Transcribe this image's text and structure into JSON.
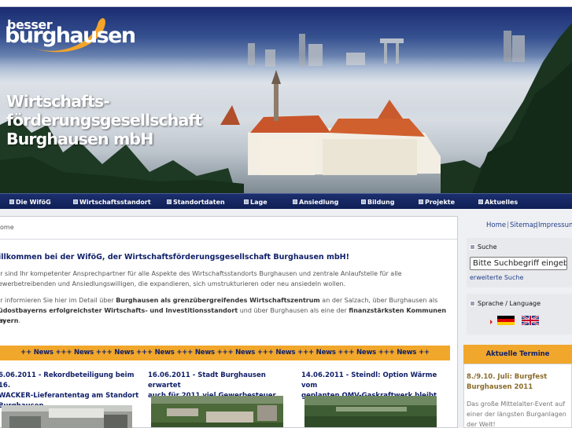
{
  "header": {
    "logo_small": "besser",
    "logo_big": "burghausen",
    "title_lines": [
      "Wirtschafts-",
      "förderungsgesellschaft",
      "Burghausen mbH"
    ]
  },
  "nav": {
    "items": [
      {
        "label": "Die WiföG"
      },
      {
        "label": "Wirtschaftsstandort"
      },
      {
        "label": "Standortdaten"
      },
      {
        "label": "Lage"
      },
      {
        "label": "Ansiedlung"
      },
      {
        "label": "Bildung"
      },
      {
        "label": "Projekte"
      },
      {
        "label": "Aktuelles"
      }
    ]
  },
  "breadcrumb": "ome",
  "main": {
    "welcome": "illkommen bei der WiföG, der Wirtschaftsförderungsgesellschaft Burghausen mbH!",
    "para1_lines": [
      "ir sind Ihr kompetenter Ansprechpartner für alle Aspekte des Wirtschaftsstandorts Burghausen und zentrale Anlaufstelle für alle",
      "ewerbetreibenden und Ansiedlungswilligen, die expandieren, sich umstrukturieren oder neu ansiedeln wollen."
    ],
    "para2": {
      "l1_a": "ir informieren Sie hier im Detail über ",
      "l1_b": "Burghausen als grenzübergreifendes Wirtschaftszentrum",
      "l1_c": " an der Salzach, über Burghausen als",
      "l2_a": "üdostbayerns erfolgreichster Wirtschafts- und Investitionsstandort",
      "l2_b": " und über Burghausen als eine der ",
      "l2_c": "finanzstärksten Kommunen in",
      "l3": "ayern",
      "l3_end": "."
    },
    "news_ticker": "++ News +++ News +++ News +++ News +++ News +++ News +++ News +++ News +++ News +++ News ++",
    "news": [
      {
        "title_lines": [
          "6.06.2011 - Rekordbeteiligung beim 16.",
          "WACKER-Lieferantentag am Standort",
          "Burghausen"
        ]
      },
      {
        "title_lines": [
          "16.06.2011 - Stadt Burghausen erwartet",
          "auch für 2011 viel Gewerbesteuer"
        ]
      },
      {
        "title_lines": [
          "14.06.2011 - Steindl: Option Wärme vom",
          "geplanten OMV-Gaskraftwerk bleibt"
        ]
      }
    ]
  },
  "sidebar": {
    "links": [
      "Home",
      "Sitemap",
      "Impressum"
    ],
    "link_sep": "|",
    "search_label": "Suche",
    "search_value": "Bitte Suchbegriff eingeb",
    "advanced_search": "erweiterte Suche",
    "language_label": "Sprache / Language",
    "flags": [
      "flag-de",
      "flag-gb"
    ],
    "termine_title": "Aktuelle Termine",
    "termin_date": "8./9.10. Juli: Burgfest Burghausen 2011",
    "termin_text": "Das große Mittelalter-Event auf einer der längsten Burganlagen der Welt!"
  },
  "colors": {
    "navy": "#10206a",
    "orange": "#f1a72b",
    "link": "#233f8c"
  }
}
